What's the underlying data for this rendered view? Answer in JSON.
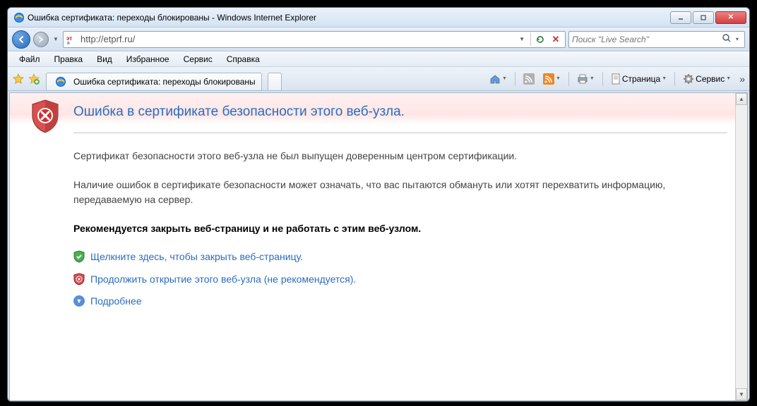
{
  "window": {
    "title": "Ошибка сертификата: переходы блокированы - Windows Internet Explorer"
  },
  "nav": {
    "url": "http://etprf.ru/",
    "search_placeholder": "Поиск \"Live Search\""
  },
  "menu": {
    "items": [
      "Файл",
      "Правка",
      "Вид",
      "Избранное",
      "Сервис",
      "Справка"
    ]
  },
  "tab": {
    "title": "Ошибка сертификата: переходы блокированы"
  },
  "cmd": {
    "page_label": "Страница",
    "tools_label": "Сервис"
  },
  "cert": {
    "heading": "Ошибка в сертификате безопасности этого веб-узла.",
    "line1": "Сертификат безопасности этого веб-узла не был выпущен доверенным центром сертификации.",
    "line2": "Наличие ошибок в сертификате безопасности может означать, что вас пытаются обмануть или хотят перехватить информацию, передаваемую на сервер.",
    "recommend": "Рекомендуется закрыть веб-страницу и не работать с этим веб-узлом.",
    "close_link": "Щелкните здесь, чтобы закрыть веб-страницу.",
    "continue_link": "Продолжить открытие этого веб-узла (не рекомендуется).",
    "more_link": "Подробнее"
  }
}
